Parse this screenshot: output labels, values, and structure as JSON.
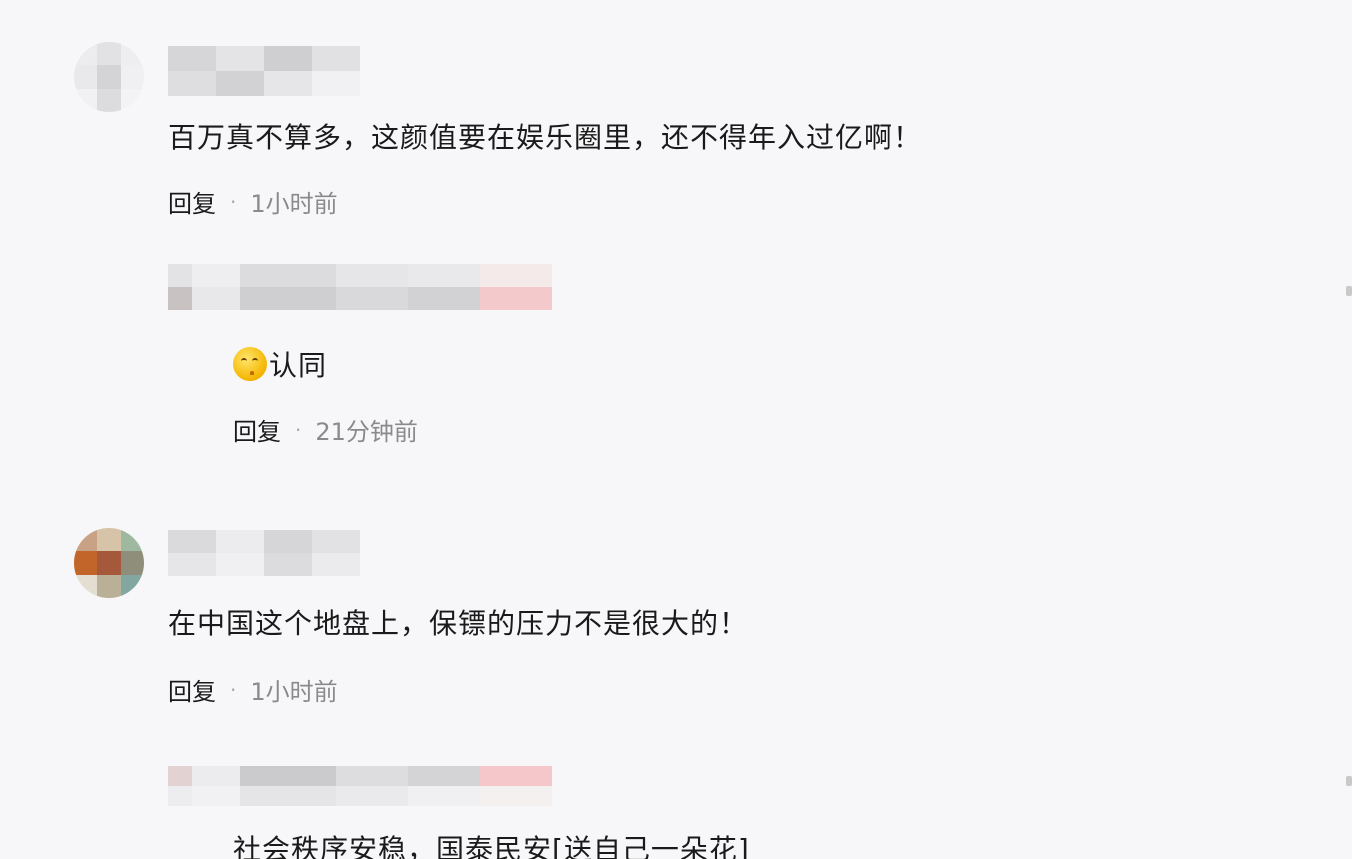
{
  "comments": [
    {
      "text": "百万真不算多，这颜值要在娱乐圈里，还不得年入过亿啊！",
      "reply_label": "回复",
      "separator": "·",
      "time": "1小时前",
      "replies": [
        {
          "emoji": "thinking-face-icon",
          "text": "认同",
          "reply_label": "回复",
          "separator": "·",
          "time": "21分钟前"
        }
      ]
    },
    {
      "text": "在中国这个地盘上，保镖的压力不是很大的！",
      "reply_label": "回复",
      "separator": "·",
      "time": "1小时前",
      "replies": [
        {
          "text": "社会秩序安稳，国泰民安[送自己一朵花]"
        }
      ]
    }
  ],
  "colors": {
    "text": "#1a1a1a",
    "time": "#8a8a8a",
    "background": "#f7f7f9"
  }
}
